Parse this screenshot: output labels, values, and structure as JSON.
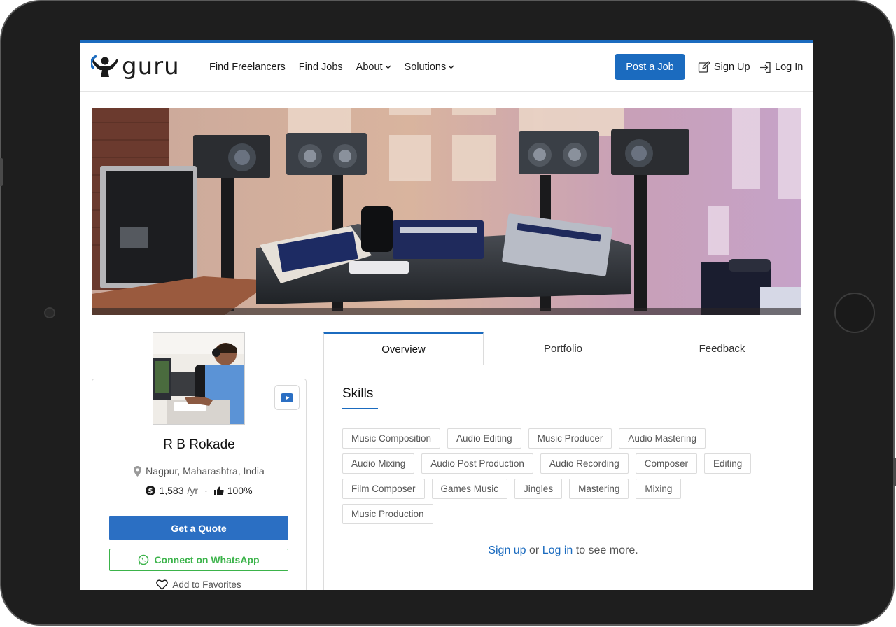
{
  "header": {
    "logo_text": "guru",
    "nav": [
      {
        "label": "Find Freelancers"
      },
      {
        "label": "Find Jobs"
      },
      {
        "label": "About",
        "dropdown": true
      },
      {
        "label": "Solutions",
        "dropdown": true
      }
    ],
    "post_job_label": "Post a Job",
    "sign_up_label": "Sign Up",
    "log_in_label": "Log In"
  },
  "profile": {
    "name": "R B Rokade",
    "location": "Nagpur, Maharashtra, India",
    "earnings": "1,583",
    "earnings_period": "/yr",
    "separator": "·",
    "rating": "100%",
    "get_quote_label": "Get a Quote",
    "whatsapp_label": "Connect on WhatsApp",
    "favorites_label": "Add to Favorites"
  },
  "tabs": [
    {
      "label": "Overview",
      "active": true
    },
    {
      "label": "Portfolio",
      "active": false
    },
    {
      "label": "Feedback",
      "active": false
    }
  ],
  "skills_section": {
    "title": "Skills",
    "skills": [
      "Music Composition",
      "Audio Editing",
      "Music Producer",
      "Audio Mastering",
      "Audio Mixing",
      "Audio Post Production",
      "Audio Recording",
      "Composer",
      "Editing",
      "Film Composer",
      "Games Music",
      "Jingles",
      "Mastering",
      "Mixing",
      "Music Production"
    ],
    "cta": {
      "sign_up": "Sign up",
      "or": " or ",
      "log_in": "Log in",
      "suffix": " to see more."
    }
  },
  "colors": {
    "brand_blue": "#1b6bbf",
    "quote_blue": "#2b6fc3",
    "whatsapp_green": "#3bb34a"
  },
  "icons": {
    "youtube": "youtube-icon",
    "location": "map-pin-icon",
    "earnings": "dollar-circle-icon",
    "rating": "thumbs-up-icon",
    "whatsapp": "whatsapp-icon",
    "favorite": "heart-icon",
    "sign_up": "edit-icon",
    "log_in": "login-icon"
  }
}
